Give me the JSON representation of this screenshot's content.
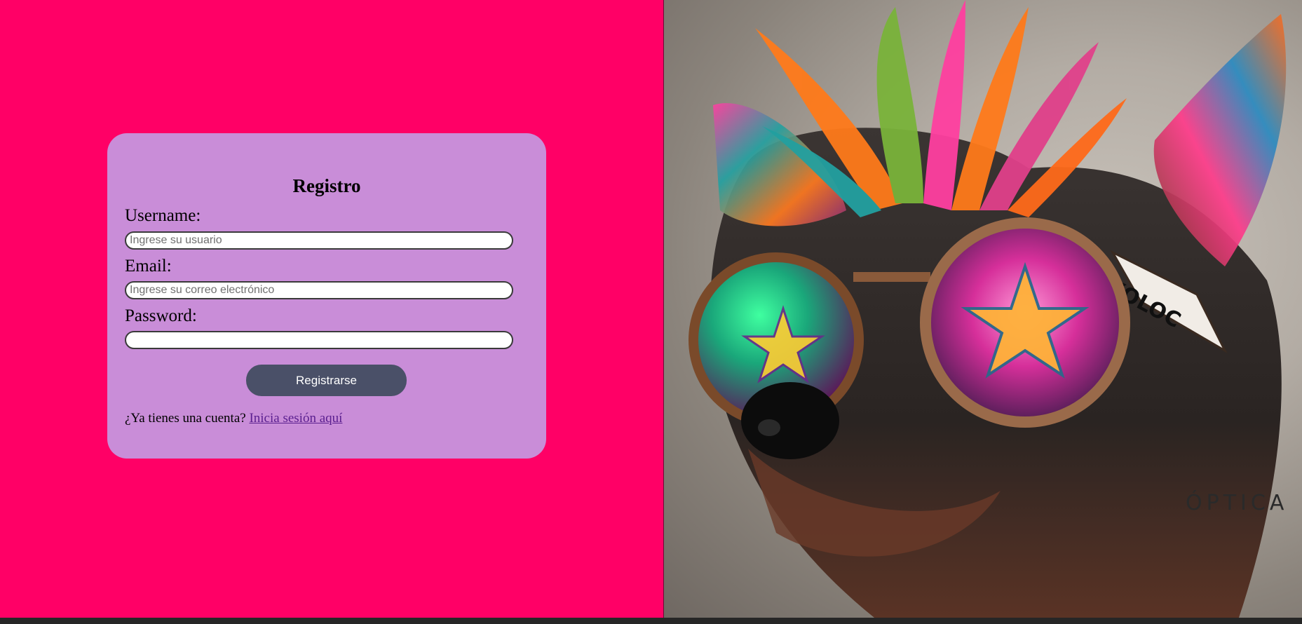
{
  "form": {
    "title": "Registro",
    "username_label": "Username:",
    "username_placeholder": "Ingrese su usuario",
    "username_value": "",
    "email_label": "Email:",
    "email_placeholder": "Ingrese su correo electrónico",
    "email_value": "",
    "password_label": "Password:",
    "password_value": "",
    "submit_label": "Registrarse",
    "login_prompt": "¿Ya tienes una cuenta?",
    "login_link": "Inicia sesión aquí"
  },
  "poster": {
    "temple_text": "XOLOC",
    "brand_text": "ÓPTICA"
  },
  "colors": {
    "page_background": "#ff0066",
    "card_background": "#c98dd8",
    "button_background": "#4a5068",
    "link": "#5a1f8f"
  }
}
